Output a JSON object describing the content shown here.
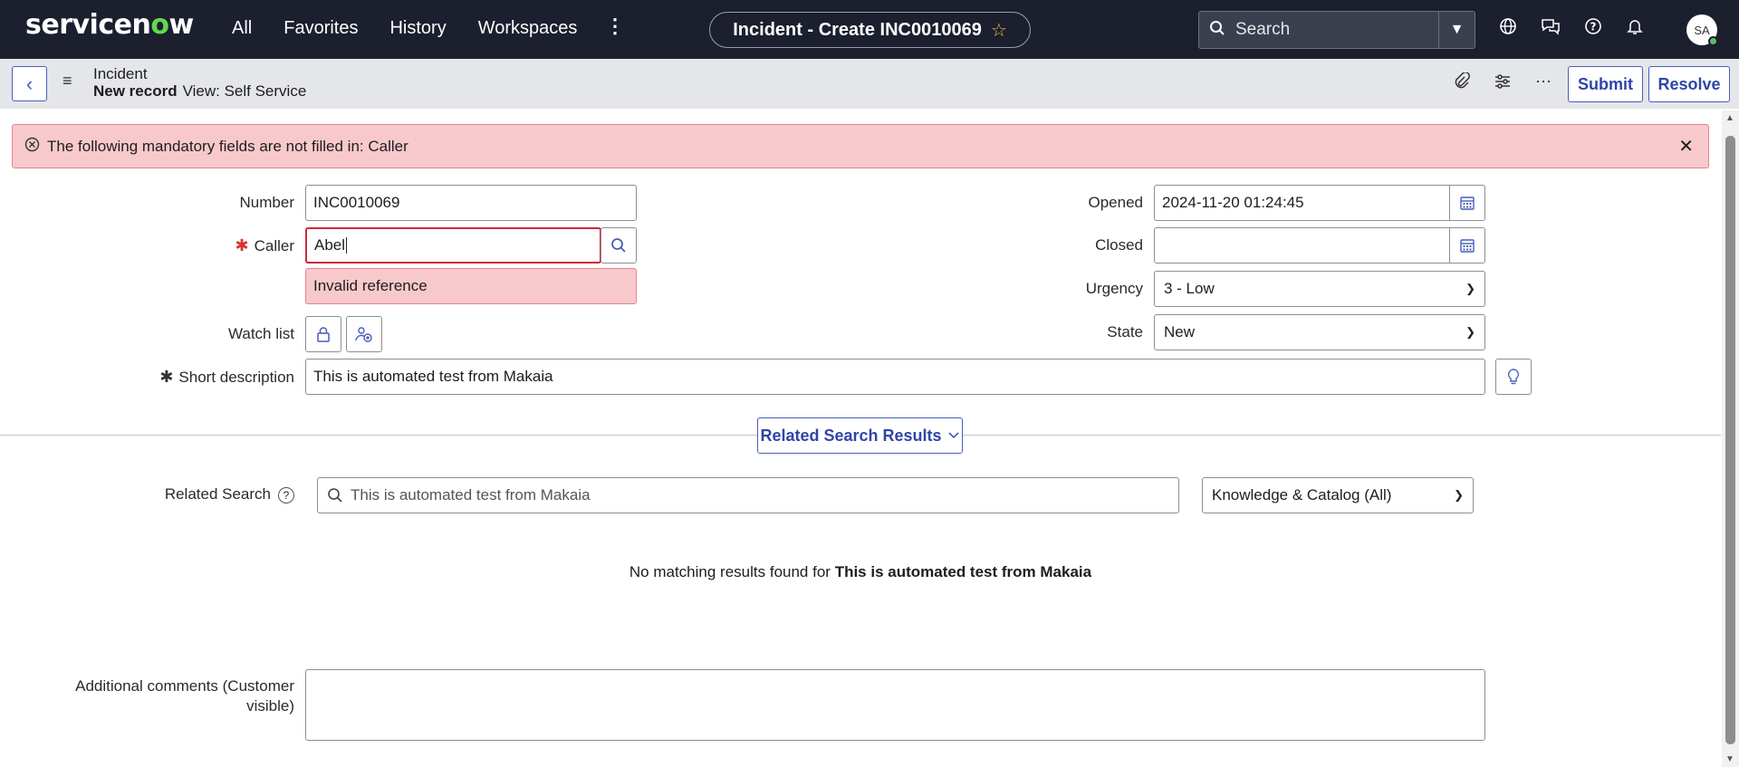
{
  "topnav": {
    "logo_text_1": "servicen",
    "logo_o": "o",
    "logo_text_2": "w",
    "menu": [
      "All",
      "Favorites",
      "History",
      "Workspaces"
    ],
    "record_title": "Incident - Create INC0010069",
    "search_placeholder": "Search",
    "avatar_initials": "SA"
  },
  "header": {
    "record_type": "Incident",
    "record_state": "New record",
    "view_label": "View: Self Service",
    "submit_label": "Submit",
    "resolve_label": "Resolve"
  },
  "error_banner": {
    "message": "The following mandatory fields are not filled in: Caller"
  },
  "form": {
    "number_label": "Number",
    "number_value": "INC0010069",
    "caller_label": "Caller",
    "caller_value": "Abel",
    "caller_error": "Invalid reference",
    "watchlist_label": "Watch list",
    "opened_label": "Opened",
    "opened_value": "2024-11-20 01:24:45",
    "closed_label": "Closed",
    "closed_value": "",
    "urgency_label": "Urgency",
    "urgency_value": "3 - Low",
    "state_label": "State",
    "state_value": "New",
    "short_desc_label": "Short description",
    "short_desc_value": "This is automated test from Makaia"
  },
  "related": {
    "button_label": "Related Search Results",
    "search_label": "Related Search",
    "search_value": "This is automated test from Makaia",
    "scope_value": "Knowledge & Catalog (All)",
    "no_results_prefix": "No matching results found for",
    "no_results_query": "This is automated test from Makaia"
  },
  "comments": {
    "label": "Additional comments (Customer visible)"
  },
  "colors": {
    "nav_bg": "#1b1f2e",
    "accent": "#4a5dbb",
    "error_bg": "#f7c9cd",
    "error_border": "#d0283a",
    "logo_green": "#62d84e"
  }
}
